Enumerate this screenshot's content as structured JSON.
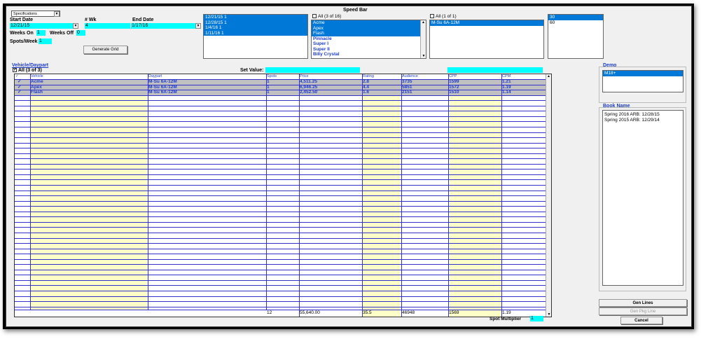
{
  "speed_bar": {
    "title": "Speed Bar"
  },
  "spec_dropdown": {
    "value": "Specifications"
  },
  "fields": {
    "start_date_label": "Start Date",
    "start_date": "12/21/15",
    "wk_label": "# Wk",
    "wk": "4",
    "end_date_label": "End Date",
    "end_date": "1/17/16",
    "weeks_on_label": "Weeks On",
    "weeks_on": "1",
    "weeks_off_label": "Weeks Off",
    "weeks_off": "0",
    "spots_week_label": "Spots/Week",
    "spots_week": "1"
  },
  "generate_grid_label": "Generate Grid",
  "week_list": [
    "12/21/15  1",
    "12/28/15  1",
    "1/4/16    1",
    "1/11/16   1"
  ],
  "vehicle_list": {
    "all_label": "All (3 of 16)",
    "items": [
      "Acme",
      "Apex",
      "Flash",
      "Pinnacle",
      "Super I",
      "Super II",
      "Billy Crystal"
    ],
    "selected_count": 3
  },
  "daypart_list": {
    "all_label": "All (1 of 1)",
    "items": [
      "M-Su 6A-12M"
    ]
  },
  "length_list": {
    "items": [
      "30",
      "60"
    ]
  },
  "grid": {
    "group_title": "Vehicle/Daypart",
    "all_label": "All (3 of 3)",
    "set_value_label": "Set Value:",
    "headers": {
      "check": "✓",
      "vehicle": "Vehicle",
      "daypart": "Daypart",
      "spots": "Spots",
      "price": "Price",
      "rating": "Rating",
      "audience": "Audience",
      "cpp": "CPP",
      "cpm": "CPM"
    },
    "rows": [
      {
        "check": "✓",
        "vehicle": "Acme",
        "daypart": "M-Su 6A-12M",
        "spots": "1",
        "price": "4,511.25",
        "rating": "2.8",
        "audience": "3735",
        "cpp": "1599",
        "cpm": "1.21"
      },
      {
        "check": "✓",
        "vehicle": "Apex",
        "daypart": "M-Su 6A-12M",
        "spots": "1",
        "price": "6,946.25",
        "rating": "4.4",
        "audience": "5851",
        "cpp": "1572",
        "cpm": "1.19"
      },
      {
        "check": "✓",
        "vehicle": "Flash",
        "daypart": "M-Su 6A-12M",
        "spots": "1",
        "price": "2,452.50",
        "rating": "1.6",
        "audience": "2151",
        "cpp": "1510",
        "cpm": "1.14"
      }
    ],
    "totals": {
      "spots": "12",
      "price": "55,640.00",
      "rating": "35.5",
      "audience": "46948",
      "cpp": "1569",
      "cpm": "1.19"
    }
  },
  "spot_multiplier": {
    "label": "Spot Multiplier",
    "value": "1"
  },
  "demo": {
    "title": "Demo",
    "items": [
      "M18+"
    ]
  },
  "book_name": {
    "title": "Book Name",
    "items": [
      "Spring 2016 ARB: 12/28/15",
      "Spring 2015 ARB: 12/29/14"
    ]
  },
  "buttons": {
    "gen_lines": "Gen Lines",
    "gen_pkg_line": "Gen Pkg Line",
    "cancel": "Cancel"
  }
}
